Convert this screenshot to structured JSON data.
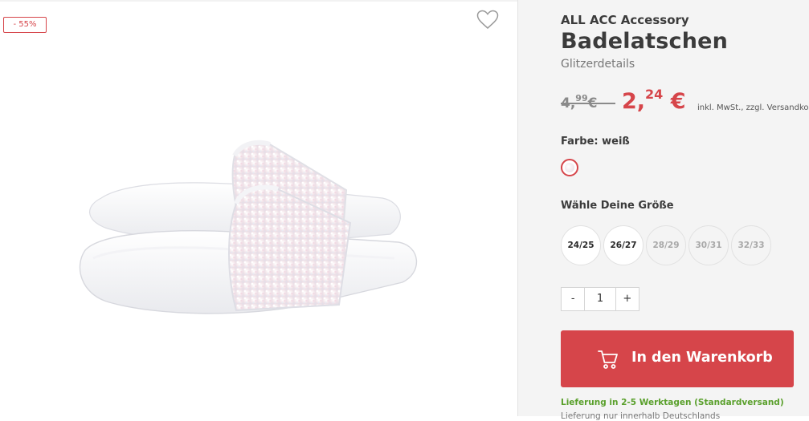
{
  "product": {
    "discount_badge": "- 55%",
    "brand": "ALL ACC Accessory",
    "title": "Badelatschen",
    "subtitle": "Glitzerdetails",
    "old_price_main": "4,",
    "old_price_cents": "99",
    "old_price_currency": "€",
    "new_price_main": "2,",
    "new_price_cents": "24",
    "new_price_currency": "€",
    "tax_note": "inkl. MwSt., zzgl. Versandkosten"
  },
  "color": {
    "label": "Farbe: weiß",
    "selected_swatch": "#ffffff"
  },
  "sizes": {
    "label": "Wähle Deine Größe",
    "options": [
      {
        "label": "24/25",
        "available": true
      },
      {
        "label": "26/27",
        "available": true
      },
      {
        "label": "28/29",
        "available": false
      },
      {
        "label": "30/31",
        "available": false
      },
      {
        "label": "32/33",
        "available": false
      }
    ]
  },
  "quantity": {
    "minus": "-",
    "value": "1",
    "plus": "+"
  },
  "cart": {
    "button_label": "In den Warenkorb",
    "icon": "cart-icon"
  },
  "delivery": {
    "line1": "Lieferung in 2-5 Werktagen (Standardversand)",
    "line2": "Lieferung nur innerhalb Deutschlands"
  },
  "icons": {
    "wishlist": "heart-outline-icon"
  },
  "colors": {
    "accent": "#d6454a",
    "delivery_green": "#5aa02c",
    "panel_bg": "#f4f4f4"
  }
}
